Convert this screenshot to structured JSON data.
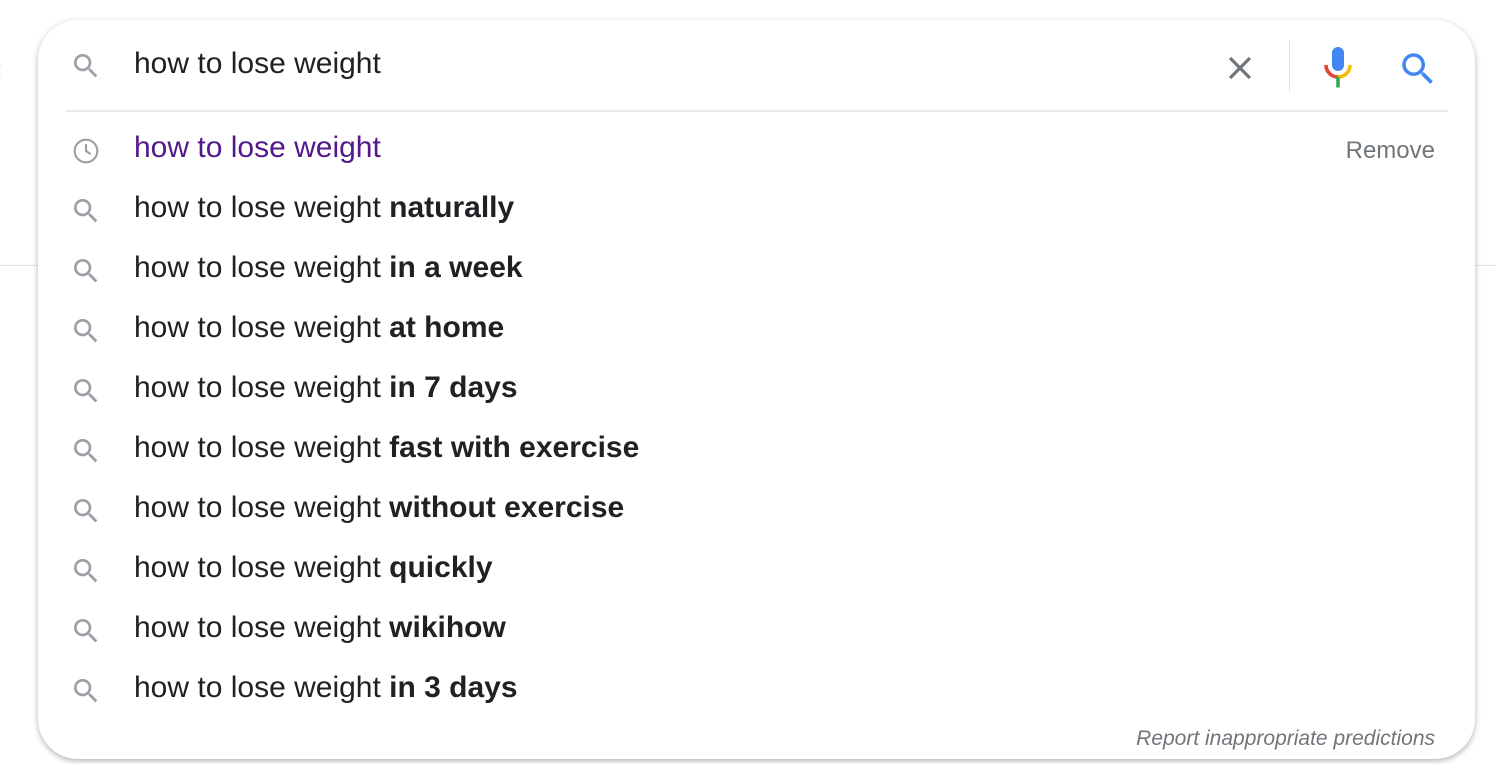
{
  "search": {
    "query": "how to lose weight"
  },
  "icons": {
    "search": "search-icon",
    "clear": "close-icon",
    "voice": "microphone-icon",
    "history": "history-clock-icon",
    "submit": "search-icon"
  },
  "colors": {
    "history_link": "#52188c",
    "text": "#202124",
    "muted": "#70757a",
    "mic_blue": "#4285f4",
    "mic_red": "#ea4335",
    "mic_yellow": "#fbbc04",
    "mic_green": "#34a853"
  },
  "suggestions": [
    {
      "type": "history",
      "prefix": "how to lose weight",
      "completion": "",
      "remove_label": "Remove"
    },
    {
      "type": "suggest",
      "prefix": "how to lose weight ",
      "completion": "naturally"
    },
    {
      "type": "suggest",
      "prefix": "how to lose weight ",
      "completion": "in a week"
    },
    {
      "type": "suggest",
      "prefix": "how to lose weight ",
      "completion": "at home"
    },
    {
      "type": "suggest",
      "prefix": "how to lose weight ",
      "completion": "in 7 days"
    },
    {
      "type": "suggest",
      "prefix": "how to lose weight ",
      "completion": "fast with exercise"
    },
    {
      "type": "suggest",
      "prefix": "how to lose weight ",
      "completion": "without exercise"
    },
    {
      "type": "suggest",
      "prefix": "how to lose weight ",
      "completion": "quickly"
    },
    {
      "type": "suggest",
      "prefix": "how to lose weight ",
      "completion": "wikihow"
    },
    {
      "type": "suggest",
      "prefix": "how to lose weight ",
      "completion": "in 3 days"
    }
  ],
  "footer": {
    "report_label": "Report inappropriate predictions"
  }
}
